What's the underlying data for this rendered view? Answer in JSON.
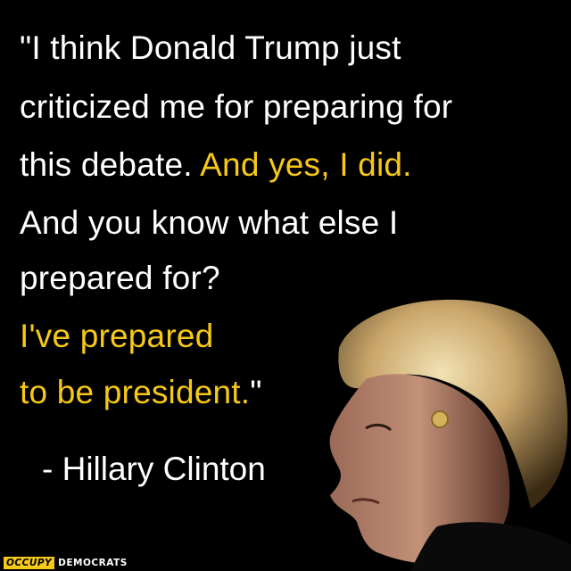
{
  "quote": {
    "line1": "\"I think Donald Trump just",
    "line2": "criticized me for preparing for",
    "line3_white": "this debate. ",
    "line3_yellow": "And yes, I did.",
    "line4": "And you know what else I",
    "line5": "prepared for?",
    "line6": "I've prepared",
    "line7_yellow": "to be president.",
    "line7_white": "\""
  },
  "attribution": "- Hillary Clinton",
  "brand": {
    "part1": "OCCUPY",
    "part2": "DEMOCRATS"
  },
  "colors": {
    "background": "#000000",
    "text": "#ffffff",
    "accent": "#f6c818"
  }
}
